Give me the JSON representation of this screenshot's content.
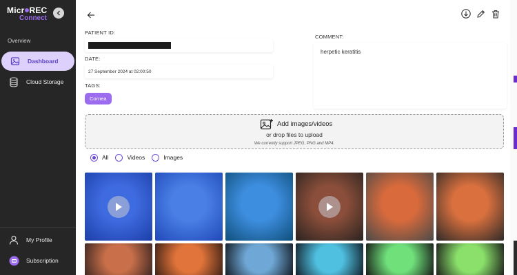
{
  "app": {
    "logo_line1_a": "Micr",
    "logo_line1_b": "REC",
    "logo_line2": "Connect"
  },
  "sidebar": {
    "section": "Overview",
    "items": [
      {
        "label": "Dashboard",
        "icon": "image-icon",
        "active": true
      },
      {
        "label": "Cloud Storage",
        "icon": "database-icon",
        "active": false
      }
    ],
    "bottom_items": [
      {
        "label": "My Profile",
        "icon": "user-icon"
      },
      {
        "label": "Subscription",
        "icon": "subscription-icon"
      }
    ]
  },
  "record": {
    "patient_id_label": "PATIENT ID:",
    "date_label": "DATE:",
    "date_value": "27 September 2024 at 02:00:50",
    "tags_label": "TAGS:",
    "tags": [
      "Cornea"
    ],
    "comment_label": "COMMENT:",
    "comment_value": "herpetic keratitis"
  },
  "upload": {
    "title": "Add images/videos",
    "subtitle": "or drop files to upload",
    "note": "We currently support JPEG, PNG and MP4."
  },
  "filters": {
    "options": [
      "All",
      "Videos",
      "Images"
    ],
    "selected": "All"
  },
  "media": [
    {
      "type": "video",
      "color_a": "#3f6be0",
      "color_b": "#1c3fa8"
    },
    {
      "type": "image",
      "color_a": "#4a7fe6",
      "color_b": "#1f49b8"
    },
    {
      "type": "image",
      "color_a": "#3e8ee0",
      "color_b": "#0f4f7a"
    },
    {
      "type": "video",
      "color_a": "#8a4e3a",
      "color_b": "#2a2320"
    },
    {
      "type": "image",
      "color_a": "#d86a3c",
      "color_b": "#4a4a48"
    },
    {
      "type": "image",
      "color_a": "#d9703e",
      "color_b": "#2e2a28"
    },
    {
      "type": "image",
      "color_a": "#c9704a",
      "color_b": "#3a2520"
    },
    {
      "type": "image",
      "color_a": "#e0743a",
      "color_b": "#3a1f15"
    },
    {
      "type": "image",
      "color_a": "#6fa8d6",
      "color_b": "#101820"
    },
    {
      "type": "image",
      "color_a": "#4fc0e0",
      "color_b": "#101a24"
    },
    {
      "type": "image",
      "color_a": "#6fe07a",
      "color_b": "#141414"
    },
    {
      "type": "image",
      "color_a": "#8ae06a",
      "color_b": "#181818"
    }
  ],
  "colors": {
    "accent": "#9b6cf0",
    "sidebar_bg": "#262626",
    "active_nav_bg": "#ddd0fb"
  }
}
